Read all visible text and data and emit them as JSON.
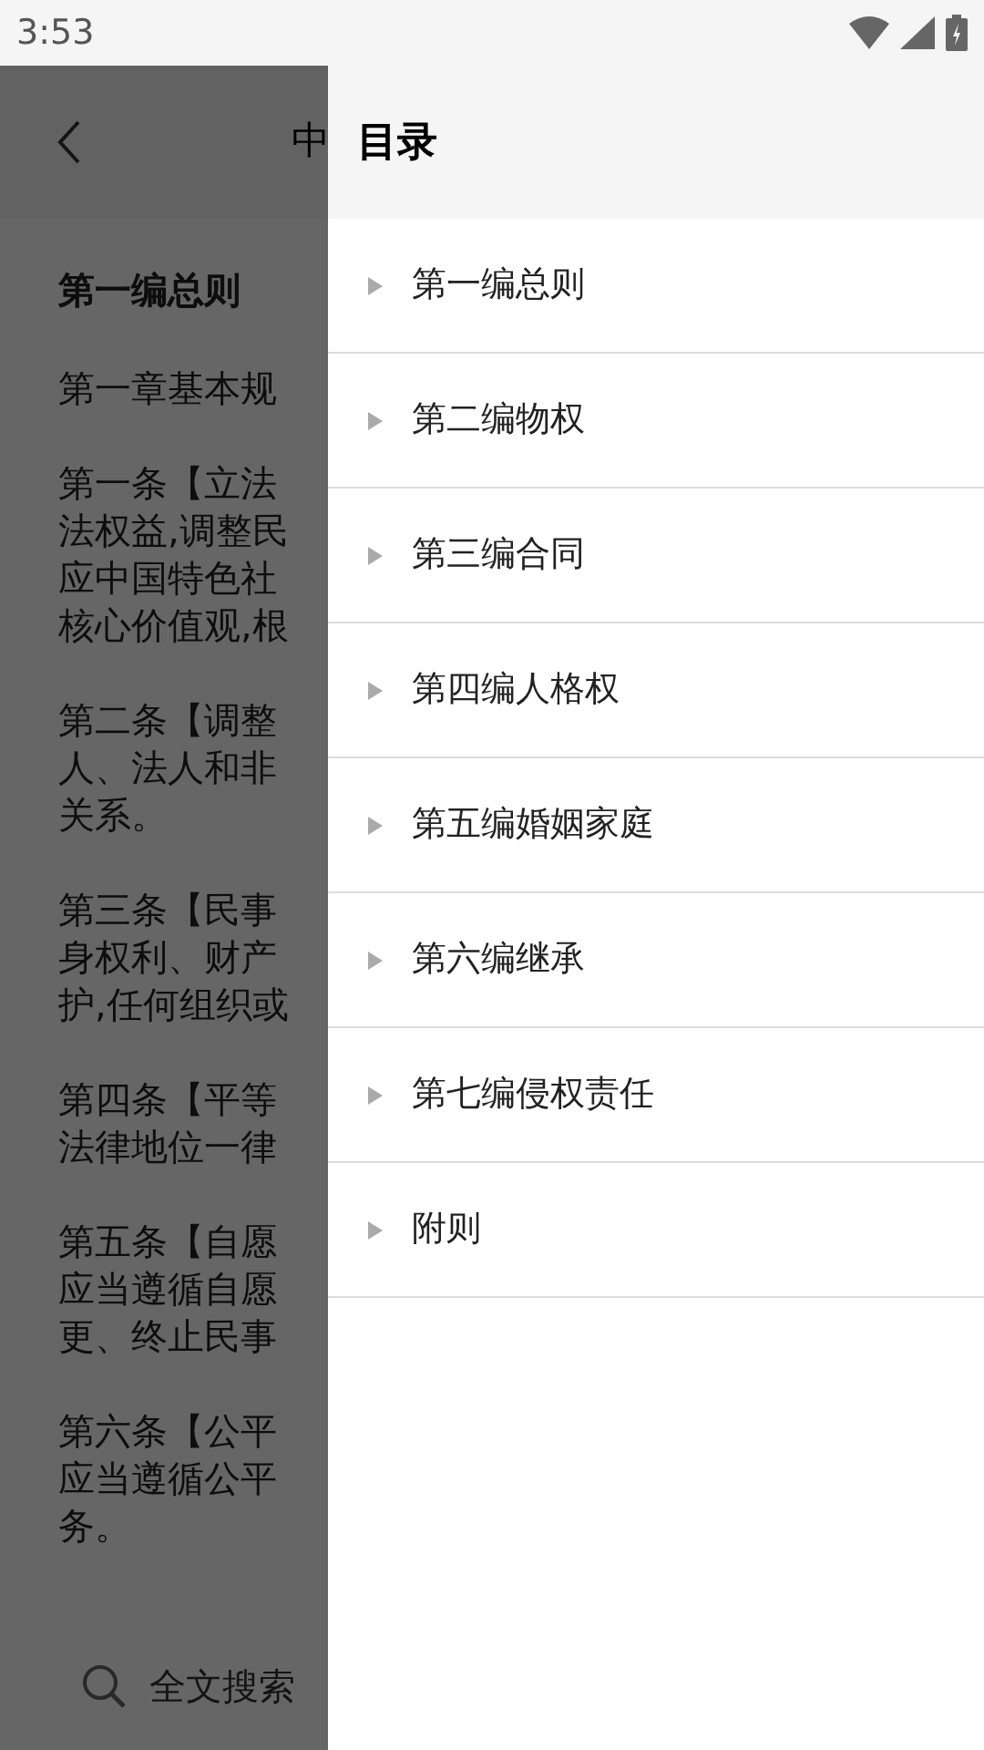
{
  "status_bar": {
    "time": "3:53"
  },
  "page": {
    "title": "中",
    "heading": "第一编总则",
    "paragraphs": [
      [
        "第一章基本规"
      ],
      [
        "第一条【立法",
        "法权益,调整民",
        "应中国特色社",
        "核心价值观,根"
      ],
      [
        "第二条【调整",
        "人、法人和非",
        "关系。"
      ],
      [
        "第三条【民事",
        "身权利、财产",
        "护,任何组织或"
      ],
      [
        "第四条【平等",
        "法律地位一律"
      ],
      [
        "第五条【自愿",
        "应当遵循自愿",
        "更、终止民事"
      ],
      [
        "第六条【公平",
        "应当遵循公平",
        "务。"
      ]
    ],
    "search": "全文搜索"
  },
  "drawer": {
    "title": "目录",
    "items": [
      "第一编总则",
      "第二编物权",
      "第三编合同",
      "第四编人格权",
      "第五编婚姻家庭",
      "第六编继承",
      "第七编侵权责任",
      "附则"
    ]
  }
}
